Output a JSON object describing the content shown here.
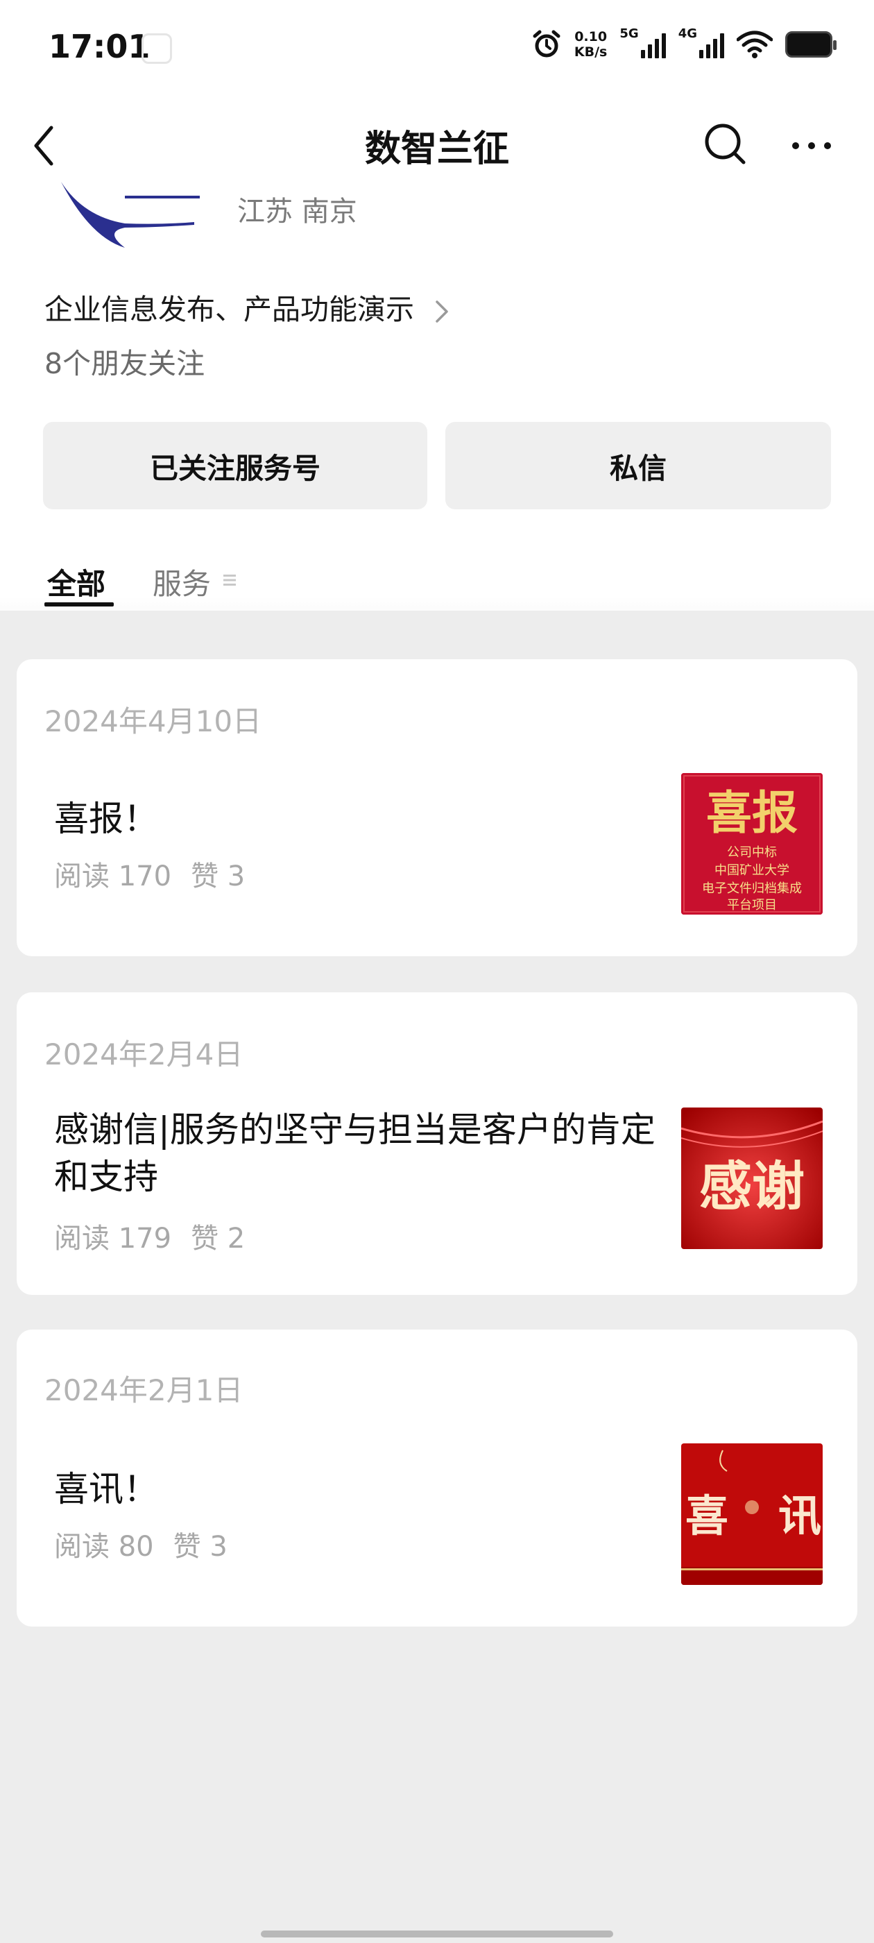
{
  "status_bar": {
    "time": "17:01",
    "net_speed_value": "0.10",
    "net_speed_unit": "KB/s",
    "signal_1_label": "5G",
    "signal_2_label": "4G",
    "icons": [
      "alarm-icon",
      "signal-5g-icon",
      "signal-4g-icon",
      "wifi-icon",
      "battery-icon"
    ]
  },
  "nav": {
    "title": "数智兰征",
    "icons": [
      "back-chevron-icon",
      "search-icon",
      "more-icon"
    ]
  },
  "profile": {
    "location": "江苏 南京",
    "description": "企业信息发布、产品功能演示",
    "friends_following": "8个朋友关注"
  },
  "actions": {
    "follow_label": "已关注服务号",
    "message_label": "私信"
  },
  "tabs": [
    {
      "label": "全部",
      "active": true
    },
    {
      "label": "服务",
      "active": false
    }
  ],
  "articles": [
    {
      "date": "2024年4月10日",
      "title": "喜报！",
      "reads": "阅读 170",
      "likes": "赞 3",
      "thumb": {
        "headline": "喜报",
        "lines": [
          "公司中标",
          "中国矿业大学",
          "电子文件归档集成",
          "平台项目"
        ]
      }
    },
    {
      "date": "2024年2月4日",
      "title": "感谢信|服务的坚守与担当是客户的肯定和支持",
      "reads": "阅读 179",
      "likes": "赞 2",
      "thumb": {
        "headline": "感谢"
      }
    },
    {
      "date": "2024年2月1日",
      "title": "喜讯！",
      "reads": "阅读 80",
      "likes": "赞 3",
      "thumb": {
        "headline_left": "喜",
        "headline_right": "讯"
      }
    }
  ],
  "colors": {
    "background": "#ededed",
    "card": "#ffffff",
    "muted_text": "#a8a8a8",
    "thumb_red": "#c8102e",
    "thumb_gold": "#f2d16b",
    "logo_blue": "#2a2f8f"
  }
}
